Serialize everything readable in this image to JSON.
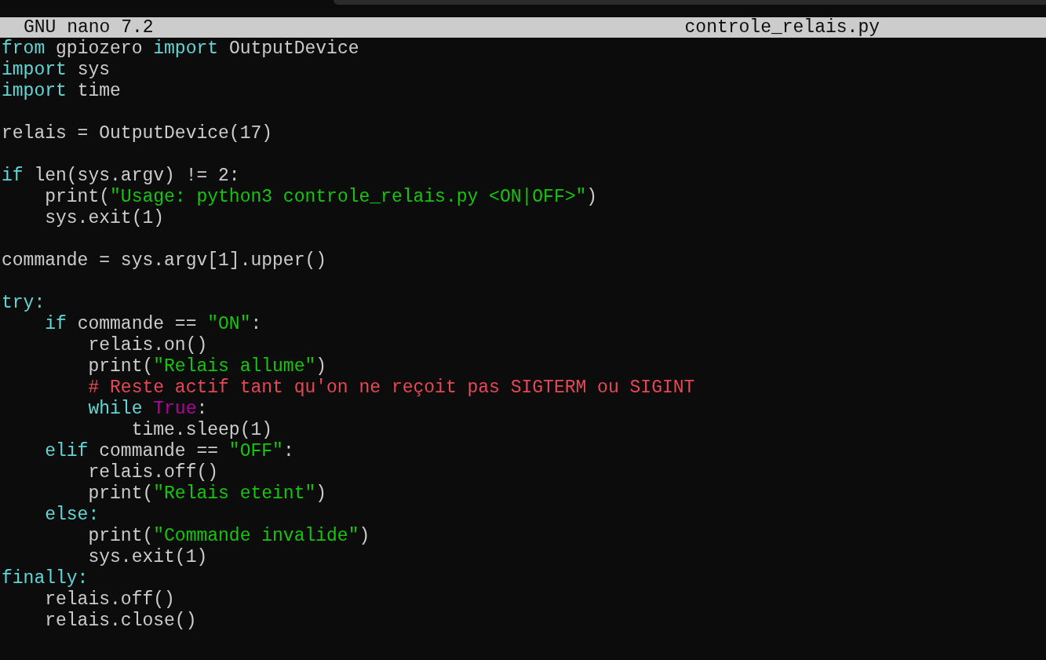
{
  "title_bar": {
    "app": "GNU nano 7.2",
    "filename": "controle_relais.py"
  },
  "lines": [
    {
      "kind": "code",
      "tokens": [
        {
          "kind": "keyword",
          "text": "from"
        },
        {
          "kind": "plain",
          "text": " gpiozero "
        },
        {
          "kind": "keyword",
          "text": "import"
        },
        {
          "kind": "plain",
          "text": " OutputDevice"
        }
      ]
    },
    {
      "kind": "code",
      "tokens": [
        {
          "kind": "keyword",
          "text": "import"
        },
        {
          "kind": "plain",
          "text": " sys"
        }
      ]
    },
    {
      "kind": "code",
      "tokens": [
        {
          "kind": "keyword",
          "text": "import"
        },
        {
          "kind": "plain",
          "text": " time"
        }
      ]
    },
    {
      "kind": "blank"
    },
    {
      "kind": "code",
      "tokens": [
        {
          "kind": "plain",
          "text": "relais = OutputDevice(17)"
        }
      ]
    },
    {
      "kind": "blank"
    },
    {
      "kind": "code",
      "tokens": [
        {
          "kind": "keyword",
          "text": "if"
        },
        {
          "kind": "plain",
          "text": " len(sys.argv) != 2:"
        }
      ]
    },
    {
      "kind": "code",
      "tokens": [
        {
          "kind": "plain",
          "text": "    print("
        },
        {
          "kind": "string",
          "text": "\"Usage: python3 controle_relais.py <ON|OFF>\""
        },
        {
          "kind": "plain",
          "text": ")"
        }
      ]
    },
    {
      "kind": "code",
      "tokens": [
        {
          "kind": "plain",
          "text": "    sys.exit(1)"
        }
      ]
    },
    {
      "kind": "blank"
    },
    {
      "kind": "code",
      "tokens": [
        {
          "kind": "plain",
          "text": "commande = sys.argv[1].upper()"
        }
      ]
    },
    {
      "kind": "blank"
    },
    {
      "kind": "code",
      "tokens": [
        {
          "kind": "keyword",
          "text": "try:"
        }
      ]
    },
    {
      "kind": "code",
      "tokens": [
        {
          "kind": "keyword",
          "text": "    if"
        },
        {
          "kind": "plain",
          "text": " commande == "
        },
        {
          "kind": "string",
          "text": "\"ON\""
        },
        {
          "kind": "plain",
          "text": ":"
        }
      ]
    },
    {
      "kind": "code",
      "tokens": [
        {
          "kind": "plain",
          "text": "        relais.on()"
        }
      ]
    },
    {
      "kind": "code",
      "tokens": [
        {
          "kind": "plain",
          "text": "        print("
        },
        {
          "kind": "string",
          "text": "\"Relais allume\""
        },
        {
          "kind": "plain",
          "text": ")"
        }
      ]
    },
    {
      "kind": "code",
      "tokens": [
        {
          "kind": "comment",
          "text": "        # Reste actif tant qu'on ne reçoit pas SIGTERM ou SIGINT"
        }
      ]
    },
    {
      "kind": "code",
      "tokens": [
        {
          "kind": "keyword",
          "text": "        while"
        },
        {
          "kind": "constant",
          "text": " True"
        },
        {
          "kind": "plain",
          "text": ":"
        }
      ]
    },
    {
      "kind": "code",
      "tokens": [
        {
          "kind": "plain",
          "text": "            time.sleep(1)"
        }
      ]
    },
    {
      "kind": "code",
      "tokens": [
        {
          "kind": "keyword",
          "text": "    elif"
        },
        {
          "kind": "plain",
          "text": " commande == "
        },
        {
          "kind": "string",
          "text": "\"OFF\""
        },
        {
          "kind": "plain",
          "text": ":"
        }
      ]
    },
    {
      "kind": "code",
      "tokens": [
        {
          "kind": "plain",
          "text": "        relais.off()"
        }
      ]
    },
    {
      "kind": "code",
      "tokens": [
        {
          "kind": "plain",
          "text": "        print("
        },
        {
          "kind": "string",
          "text": "\"Relais eteint\""
        },
        {
          "kind": "plain",
          "text": ")"
        }
      ]
    },
    {
      "kind": "code",
      "tokens": [
        {
          "kind": "keyword",
          "text": "    else:"
        }
      ]
    },
    {
      "kind": "code",
      "tokens": [
        {
          "kind": "plain",
          "text": "        print("
        },
        {
          "kind": "string",
          "text": "\"Commande invalide\""
        },
        {
          "kind": "plain",
          "text": ")"
        }
      ]
    },
    {
      "kind": "code",
      "tokens": [
        {
          "kind": "plain",
          "text": "        sys.exit(1)"
        }
      ]
    },
    {
      "kind": "code",
      "tokens": [
        {
          "kind": "keyword",
          "text": "finally:"
        }
      ]
    },
    {
      "kind": "code",
      "tokens": [
        {
          "kind": "plain",
          "text": "    relais.off()"
        }
      ]
    },
    {
      "kind": "code",
      "tokens": [
        {
          "kind": "plain",
          "text": "    relais.close()"
        }
      ]
    }
  ]
}
